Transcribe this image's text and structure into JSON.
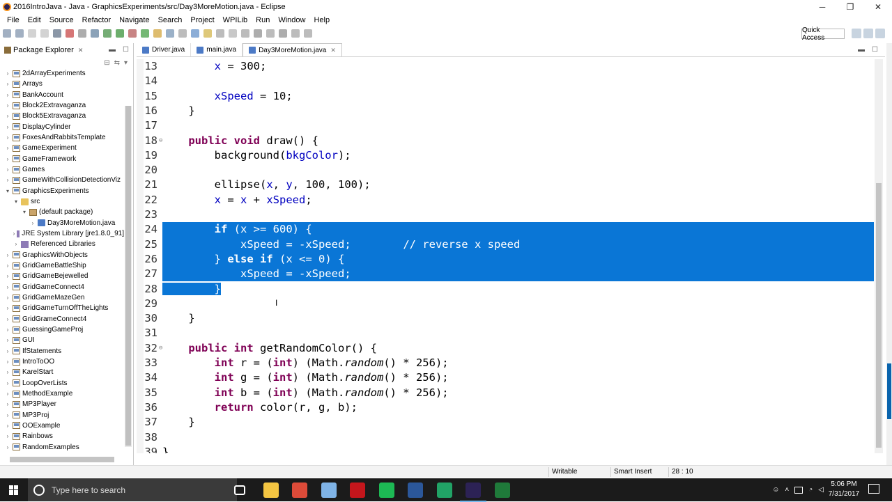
{
  "window": {
    "title": "2016IntroJava - Java - GraphicsExperiments/src/Day3MoreMotion.java - Eclipse",
    "controls": [
      "─",
      "❐",
      "✕"
    ]
  },
  "menu": [
    "File",
    "Edit",
    "Source",
    "Refactor",
    "Navigate",
    "Search",
    "Project",
    "WPILib",
    "Run",
    "Window",
    "Help"
  ],
  "toolbar": {
    "quick_access": "Quick Access"
  },
  "package_explorer": {
    "title": "Package Explorer",
    "items": [
      {
        "label": "2dArrayExperiments",
        "depth": 0,
        "kind": "project",
        "expanded": false
      },
      {
        "label": "Arrays",
        "depth": 0,
        "kind": "project",
        "expanded": false
      },
      {
        "label": "BankAccount",
        "depth": 0,
        "kind": "project",
        "expanded": false
      },
      {
        "label": "Block2Extravaganza",
        "depth": 0,
        "kind": "project",
        "expanded": false
      },
      {
        "label": "Block5Extravaganza",
        "depth": 0,
        "kind": "project",
        "expanded": false
      },
      {
        "label": "DisplayCylinder",
        "depth": 0,
        "kind": "project",
        "expanded": false
      },
      {
        "label": "FoxesAndRabbitsTemplate",
        "depth": 0,
        "kind": "project",
        "expanded": false
      },
      {
        "label": "GameExperiment",
        "depth": 0,
        "kind": "project",
        "expanded": false
      },
      {
        "label": "GameFramework",
        "depth": 0,
        "kind": "project",
        "expanded": false
      },
      {
        "label": "Games",
        "depth": 0,
        "kind": "project",
        "expanded": false
      },
      {
        "label": "GameWithCollisionDetectionViz",
        "depth": 0,
        "kind": "project",
        "expanded": false
      },
      {
        "label": "GraphicsExperiments",
        "depth": 0,
        "kind": "project",
        "expanded": true
      },
      {
        "label": "src",
        "depth": 1,
        "kind": "folder",
        "expanded": true
      },
      {
        "label": "(default package)",
        "depth": 2,
        "kind": "package",
        "expanded": true
      },
      {
        "label": "Day3MoreMotion.java",
        "depth": 3,
        "kind": "file",
        "expanded": false
      },
      {
        "label": "JRE System Library [jre1.8.0_91]",
        "depth": 1,
        "kind": "jar",
        "expanded": false
      },
      {
        "label": "Referenced Libraries",
        "depth": 1,
        "kind": "jar",
        "expanded": false
      },
      {
        "label": "GraphicsWithObjects",
        "depth": 0,
        "kind": "project",
        "expanded": false
      },
      {
        "label": "GridGameBattleShip",
        "depth": 0,
        "kind": "project",
        "expanded": false
      },
      {
        "label": "GridGameBejewelled",
        "depth": 0,
        "kind": "project",
        "expanded": false
      },
      {
        "label": "GridGameConnect4",
        "depth": 0,
        "kind": "project",
        "expanded": false
      },
      {
        "label": "GridGameMazeGen",
        "depth": 0,
        "kind": "project",
        "expanded": false
      },
      {
        "label": "GridGameTurnOffTheLights",
        "depth": 0,
        "kind": "project",
        "expanded": false
      },
      {
        "label": "GridGrameConnect4",
        "depth": 0,
        "kind": "project",
        "expanded": false
      },
      {
        "label": "GuessingGameProj",
        "depth": 0,
        "kind": "project",
        "expanded": false
      },
      {
        "label": "GUI",
        "depth": 0,
        "kind": "project",
        "expanded": false
      },
      {
        "label": "IfStatements",
        "depth": 0,
        "kind": "project",
        "expanded": false
      },
      {
        "label": "IntroToOO",
        "depth": 0,
        "kind": "project",
        "expanded": false
      },
      {
        "label": "KarelStart",
        "depth": 0,
        "kind": "project",
        "expanded": false
      },
      {
        "label": "LoopOverLists",
        "depth": 0,
        "kind": "project",
        "expanded": false
      },
      {
        "label": "MethodExample",
        "depth": 0,
        "kind": "project",
        "expanded": false
      },
      {
        "label": "MP3Player",
        "depth": 0,
        "kind": "project",
        "expanded": false
      },
      {
        "label": "MP3Proj",
        "depth": 0,
        "kind": "project",
        "expanded": false
      },
      {
        "label": "OOExample",
        "depth": 0,
        "kind": "project",
        "expanded": false
      },
      {
        "label": "Rainbows",
        "depth": 0,
        "kind": "project",
        "expanded": false
      },
      {
        "label": "RandomExamples",
        "depth": 0,
        "kind": "project",
        "expanded": false
      }
    ]
  },
  "editor": {
    "tabs": [
      {
        "label": "Driver.java",
        "active": false
      },
      {
        "label": "main.java",
        "active": false
      },
      {
        "label": "Day3MoreMotion.java",
        "active": true
      }
    ],
    "lines": [
      {
        "n": "13",
        "tokens": [
          [
            "",
            "        "
          ],
          [
            "fld",
            "x"
          ],
          [
            "",
            " = 300;"
          ]
        ]
      },
      {
        "n": "14",
        "tokens": []
      },
      {
        "n": "15",
        "tokens": [
          [
            "",
            "        "
          ],
          [
            "fld",
            "xSpeed"
          ],
          [
            "",
            " = 10;"
          ]
        ]
      },
      {
        "n": "16",
        "tokens": [
          [
            "",
            "    }"
          ]
        ]
      },
      {
        "n": "17",
        "tokens": []
      },
      {
        "n": "18",
        "fold": "⊖",
        "tokens": [
          [
            "",
            "    "
          ],
          [
            "kw",
            "public"
          ],
          [
            "",
            " "
          ],
          [
            "kw",
            "void"
          ],
          [
            "",
            " draw() {"
          ]
        ]
      },
      {
        "n": "19",
        "tokens": [
          [
            "",
            "        background("
          ],
          [
            "fld",
            "bkgColor"
          ],
          [
            "",
            ");"
          ]
        ]
      },
      {
        "n": "20",
        "tokens": []
      },
      {
        "n": "21",
        "tokens": [
          [
            "",
            "        ellipse("
          ],
          [
            "fld",
            "x"
          ],
          [
            "",
            ", "
          ],
          [
            "fld",
            "y"
          ],
          [
            "",
            ", 100, 100);"
          ]
        ]
      },
      {
        "n": "22",
        "tokens": [
          [
            "",
            "        "
          ],
          [
            "fld",
            "x"
          ],
          [
            "",
            " = "
          ],
          [
            "fld",
            "x"
          ],
          [
            "",
            " + "
          ],
          [
            "fld",
            "xSpeed"
          ],
          [
            "",
            ";"
          ]
        ]
      },
      {
        "n": "23",
        "tokens": []
      },
      {
        "n": "24",
        "sel": true,
        "tokens": [
          [
            "",
            "        "
          ],
          [
            "kw",
            "if"
          ],
          [
            "",
            " ("
          ],
          [
            "fld",
            "x"
          ],
          [
            "",
            " >= 600) {"
          ]
        ]
      },
      {
        "n": "25",
        "sel": true,
        "tokens": [
          [
            "",
            "            "
          ],
          [
            "fld",
            "xSpeed"
          ],
          [
            "",
            " = -"
          ],
          [
            "fld",
            "xSpeed"
          ],
          [
            "",
            ";        "
          ],
          [
            "cm",
            "// reverse x speed"
          ]
        ]
      },
      {
        "n": "26",
        "sel": true,
        "tokens": [
          [
            "",
            "        } "
          ],
          [
            "kw",
            "else"
          ],
          [
            "",
            " "
          ],
          [
            "kw",
            "if"
          ],
          [
            "",
            " ("
          ],
          [
            "fld",
            "x"
          ],
          [
            "",
            " <= 0) {"
          ]
        ]
      },
      {
        "n": "27",
        "sel": true,
        "tokens": [
          [
            "",
            "            "
          ],
          [
            "fld",
            "xSpeed"
          ],
          [
            "",
            " = -"
          ],
          [
            "fld",
            "xSpeed"
          ],
          [
            "",
            ";"
          ]
        ]
      },
      {
        "n": "28",
        "selpartial": true,
        "tokens": [
          [
            "",
            "        }"
          ]
        ]
      },
      {
        "n": "29",
        "tokens": []
      },
      {
        "n": "30",
        "tokens": [
          [
            "",
            "    }"
          ]
        ]
      },
      {
        "n": "31",
        "tokens": []
      },
      {
        "n": "32",
        "fold": "⊖",
        "tokens": [
          [
            "",
            "    "
          ],
          [
            "kw",
            "public"
          ],
          [
            "",
            " "
          ],
          [
            "kw",
            "int"
          ],
          [
            "",
            " getRandomColor() {"
          ]
        ]
      },
      {
        "n": "33",
        "tokens": [
          [
            "",
            "        "
          ],
          [
            "kw",
            "int"
          ],
          [
            "",
            " r = ("
          ],
          [
            "kw",
            "int"
          ],
          [
            "",
            ") (Math."
          ],
          [
            "it",
            "random"
          ],
          [
            "",
            "() * 256);"
          ]
        ]
      },
      {
        "n": "34",
        "tokens": [
          [
            "",
            "        "
          ],
          [
            "kw",
            "int"
          ],
          [
            "",
            " g = ("
          ],
          [
            "kw",
            "int"
          ],
          [
            "",
            ") (Math."
          ],
          [
            "it",
            "random"
          ],
          [
            "",
            "() * 256);"
          ]
        ]
      },
      {
        "n": "35",
        "tokens": [
          [
            "",
            "        "
          ],
          [
            "kw",
            "int"
          ],
          [
            "",
            " b = ("
          ],
          [
            "kw",
            "int"
          ],
          [
            "",
            ") (Math."
          ],
          [
            "it",
            "random"
          ],
          [
            "",
            "() * 256);"
          ]
        ]
      },
      {
        "n": "36",
        "tokens": [
          [
            "",
            "        "
          ],
          [
            "kw",
            "return"
          ],
          [
            "",
            " color(r, g, b);"
          ]
        ]
      },
      {
        "n": "37",
        "tokens": [
          [
            "",
            "    }"
          ]
        ]
      },
      {
        "n": "38",
        "tokens": []
      },
      {
        "n": "39",
        "tokens": [
          [
            "",
            "}"
          ]
        ]
      }
    ]
  },
  "status": {
    "writable": "Writable",
    "insert_mode": "Smart Insert",
    "position": "28 : 10"
  },
  "taskbar": {
    "search_placeholder": "Type here to search",
    "time": "5:06 PM",
    "date": "7/31/2017",
    "apps": [
      {
        "name": "task-view-icon",
        "color": "#1b1b1b"
      },
      {
        "name": "file-explorer-icon",
        "color": "#f4c542"
      },
      {
        "name": "chrome-icon",
        "color": "#dd4b39"
      },
      {
        "name": "notepad-icon",
        "color": "#7fb3e6"
      },
      {
        "name": "acrobat-icon",
        "color": "#c4161c"
      },
      {
        "name": "spotify-icon",
        "color": "#1db954"
      },
      {
        "name": "word-icon",
        "color": "#2b579a"
      },
      {
        "name": "excel-icon",
        "color": "#21a366"
      },
      {
        "name": "eclipse-icon",
        "color": "#2c2255"
      },
      {
        "name": "greenfoot-icon",
        "color": "#1f7a3a"
      }
    ]
  }
}
